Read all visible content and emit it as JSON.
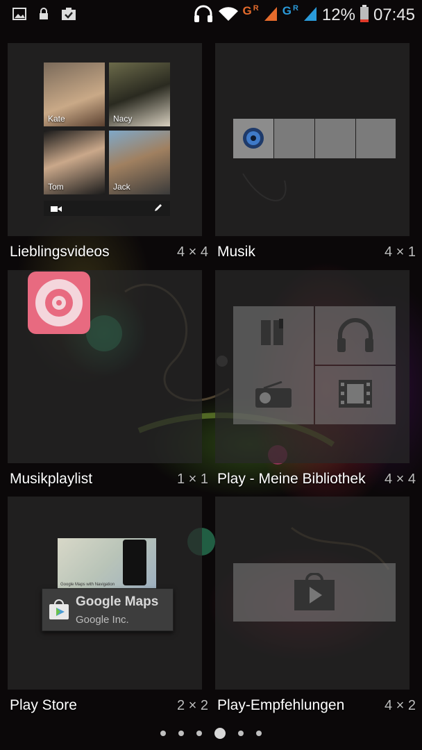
{
  "status_bar": {
    "left_icons": [
      "gallery-icon",
      "lock-icon",
      "clipboard-check-icon"
    ],
    "network": [
      {
        "letter": "G",
        "roaming": "R",
        "color": "#e56b2c"
      },
      {
        "letter": "G",
        "roaming": "R",
        "color": "#2a9ad9"
      }
    ],
    "battery": "12%",
    "time": "07:45"
  },
  "widgets": [
    {
      "name": "Lieblingsvideos",
      "size": "4 × 4",
      "contacts": [
        "Kate",
        "Nacy",
        "Tom",
        "Jack"
      ]
    },
    {
      "name": "Musik",
      "size": "4 × 1"
    },
    {
      "name": "Musikplaylist",
      "size": "1 × 1"
    },
    {
      "name": "Play - Meine Bibliothek",
      "size": "4 × 4"
    },
    {
      "name": "Play Store",
      "size": "2 × 2",
      "preview": {
        "app": "Google Maps",
        "publisher": "Google Inc.",
        "caption": "Google Maps with Navigation"
      }
    },
    {
      "name": "Play-Empfehlungen",
      "size": "4 × 2"
    }
  ],
  "page_indicator": {
    "count": 6,
    "active": 3
  },
  "colors": {
    "accent_orange": "#e56b2c",
    "accent_blue": "#2a9ad9",
    "tile_bg": "#282828",
    "playlist_pink": "#e86a80"
  }
}
